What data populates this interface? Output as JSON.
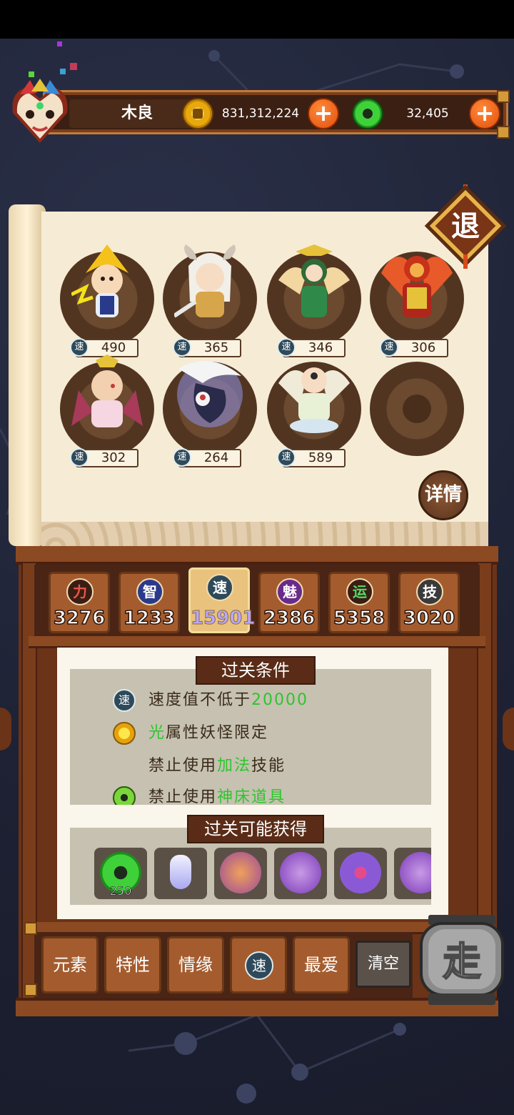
{
  "header": {
    "player_name": "木良",
    "gold": "831,312,224",
    "jade": "32,405",
    "plus_label": "+"
  },
  "exit_label": "退",
  "detail_label": "详情",
  "speed_glyph": "速",
  "heroes": [
    {
      "speed": "490"
    },
    {
      "speed": "365"
    },
    {
      "speed": "346"
    },
    {
      "speed": "306"
    },
    {
      "speed": "302"
    },
    {
      "speed": "264"
    },
    {
      "speed": "589"
    },
    {
      "speed": ""
    }
  ],
  "stats": [
    {
      "glyph": "力",
      "value": "3276",
      "color": "#c0392b"
    },
    {
      "glyph": "智",
      "value": "1233",
      "color": "#3a5bd9"
    },
    {
      "glyph": "速",
      "value": "15901",
      "color": "#2e4a5a"
    },
    {
      "glyph": "魅",
      "value": "2386",
      "color": "#9b3ab8"
    },
    {
      "glyph": "运",
      "value": "5358",
      "color": "#2d8a3a"
    },
    {
      "glyph": "技",
      "value": "3020",
      "color": "#4a4a4a"
    }
  ],
  "conditions": {
    "title": "过关条件",
    "rows": [
      {
        "prefix": "速度值不低于",
        "highlight": "20000",
        "suffix": ""
      },
      {
        "prefix": "",
        "highlight": "光",
        "suffix": "属性妖怪限定"
      },
      {
        "prefix": "禁止使用",
        "highlight": "加法",
        "suffix": "技能"
      },
      {
        "prefix": "禁止使用",
        "highlight": "神床道具",
        "suffix": ""
      }
    ]
  },
  "rewards": {
    "title": "过关可能获得",
    "items": [
      {
        "count": "250"
      },
      {
        "count": ""
      },
      {
        "count": ""
      },
      {
        "count": ""
      },
      {
        "count": ""
      },
      {
        "count": ""
      }
    ]
  },
  "filters": {
    "element": "元素",
    "trait": "特性",
    "bond": "情缘",
    "speed": "速",
    "favorite": "最爱",
    "clear": "清空"
  },
  "go_label": "走"
}
